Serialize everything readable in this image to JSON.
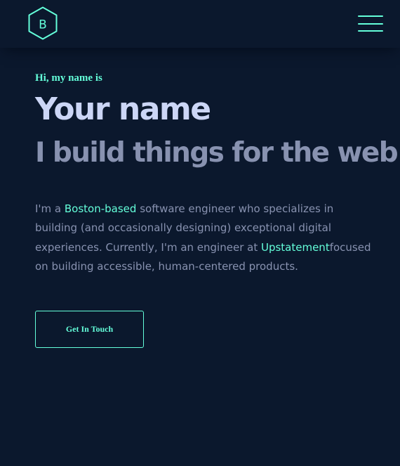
{
  "colors": {
    "background": "#0b182d",
    "accent": "#64ffda",
    "heading": "#ccd6f6",
    "body_text": "#8892b0"
  },
  "header": {
    "logo": {
      "icon": "hexagon-logo-icon",
      "letter": "B"
    },
    "menu": {
      "icon": "hamburger-menu-icon"
    }
  },
  "hero": {
    "greeting": "Hi, my name is",
    "name": "Your name",
    "tagline": "I build things for the web",
    "bio": {
      "part1": "I'm a ",
      "link1": "Boston-based",
      "part2": " software engineer who specializes in building (and occasionally designing) exceptional digital experiences. Currently, I'm an engineer at ",
      "link2": "Upstatement",
      "part3": "focused on building accessible, human-centered products."
    },
    "cta_label": "Get In Touch"
  }
}
